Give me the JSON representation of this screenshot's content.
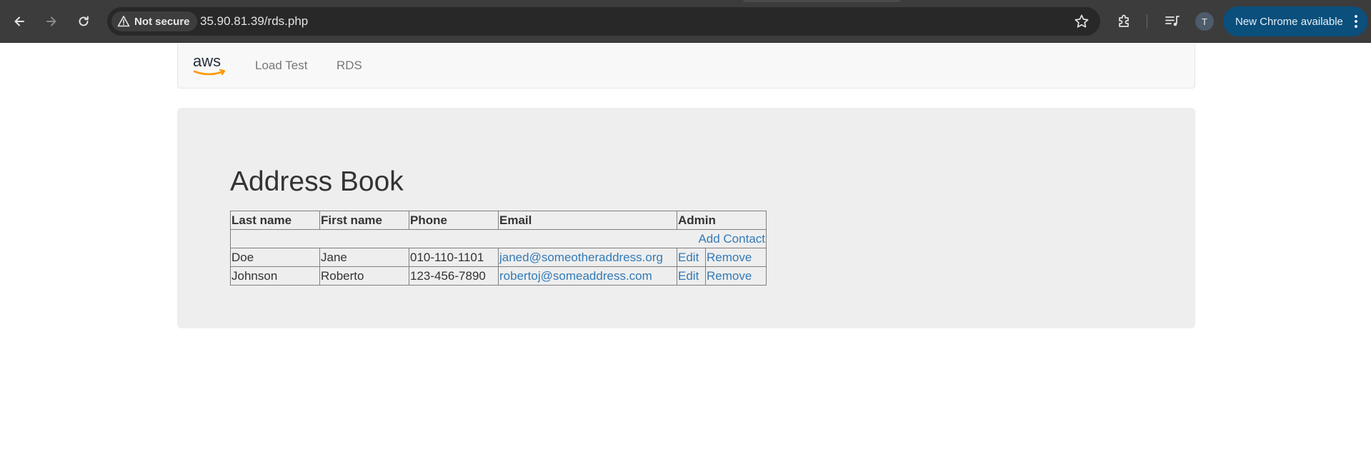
{
  "browser": {
    "security_label": "Not secure",
    "url": "35.90.81.39/rds.php",
    "profile_initial": "T",
    "update_label": "New Chrome available"
  },
  "navbar": {
    "logo_text": "aws",
    "links": [
      {
        "label": "Load Test"
      },
      {
        "label": "RDS"
      }
    ]
  },
  "main": {
    "title": "Address Book",
    "table": {
      "headers": [
        "Last name",
        "First name",
        "Phone",
        "Email",
        "Admin"
      ],
      "add_contact_label": "Add Contact",
      "rows": [
        {
          "last": "Doe",
          "first": "Jane",
          "phone": "010-110-1101",
          "email": "janed@someotheraddress.org",
          "edit": "Edit",
          "remove": "Remove"
        },
        {
          "last": "Johnson",
          "first": "Roberto",
          "phone": "123-456-7890",
          "email": "robertoj@someaddress.com",
          "edit": "Edit",
          "remove": "Remove"
        }
      ]
    }
  },
  "colors": {
    "link": "#337ab7",
    "jumbotron_bg": "#eeeeee",
    "navbar_bg": "#f8f8f8",
    "aws_orange": "#f90",
    "chrome_update_chip": "#0b4f7c"
  }
}
